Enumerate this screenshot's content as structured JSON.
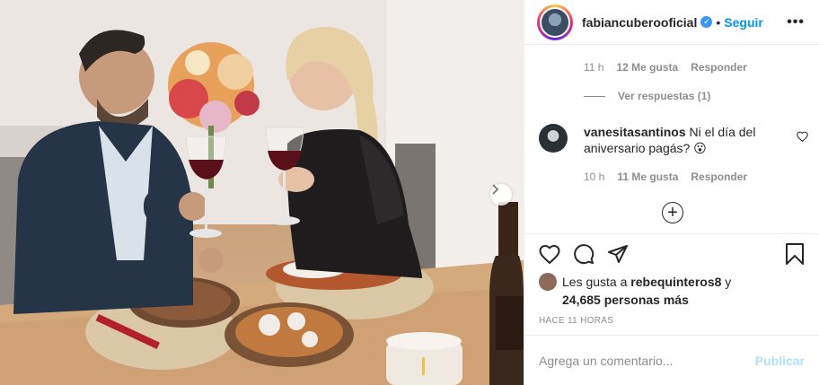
{
  "header": {
    "username": "fabiancuberooficial",
    "dot": "•",
    "follow_label": "Seguir",
    "more_label": "•••"
  },
  "comments": {
    "prev_meta": {
      "time": "11 h",
      "likes": "12 Me gusta",
      "reply": "Responder"
    },
    "view_replies": "Ver respuestas (1)",
    "comment": {
      "user": "vanesitasantinos",
      "text": "Ni el día del aniversario pagás? 😮",
      "time": "10 h",
      "likes": "11 Me gusta",
      "reply": "Responder"
    },
    "load_more_label": "+"
  },
  "likes": {
    "prefix": "Les gusta a ",
    "user": "rebequinteros8",
    "middle": " y ",
    "count": "24,685 personas más"
  },
  "timestamp": "HACE 11 HORAS",
  "add_comment": {
    "placeholder": "Agrega un comentario...",
    "publish_label": "Publicar"
  },
  "icons": [
    "chevron-right-icon",
    "verified-icon",
    "heart-icon",
    "comment-icon",
    "share-icon",
    "bookmark-icon",
    "heart-small-icon",
    "plus-circle-icon"
  ],
  "colors": {
    "accent": "#0095f6",
    "publish_disabled": "#b2dffc",
    "muted": "#8e8e8e",
    "text": "#262626"
  }
}
